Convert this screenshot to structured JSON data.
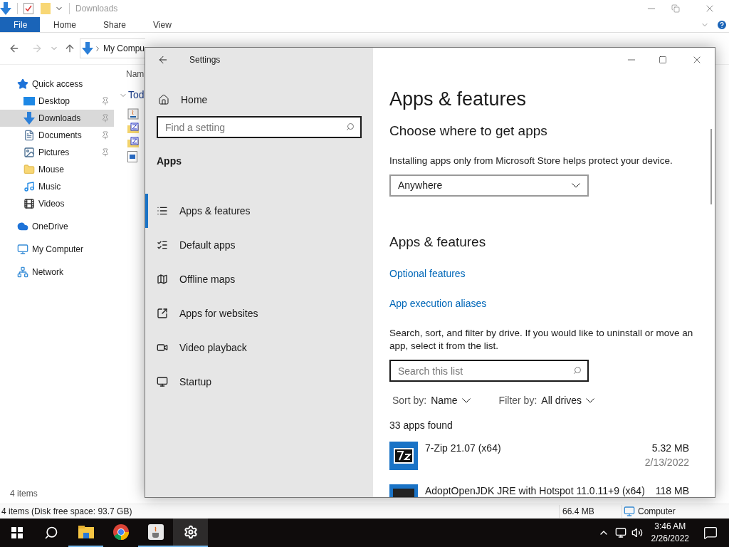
{
  "explorer": {
    "title": "Downloads",
    "ribbon_tabs": [
      {
        "label": "File",
        "selected": true
      },
      {
        "label": "Home",
        "selected": false
      },
      {
        "label": "Share",
        "selected": false
      },
      {
        "label": "View",
        "selected": false
      }
    ],
    "breadcrumb": "My Compu",
    "nav": [
      {
        "label": "Quick access",
        "kind": "star",
        "selected": false,
        "pinned": false,
        "group": true
      },
      {
        "label": "Desktop",
        "kind": "desktop",
        "selected": false,
        "pinned": true,
        "group": false
      },
      {
        "label": "Downloads",
        "kind": "download",
        "selected": true,
        "pinned": true,
        "group": false
      },
      {
        "label": "Documents",
        "kind": "document",
        "selected": false,
        "pinned": true,
        "group": false
      },
      {
        "label": "Pictures",
        "kind": "picture",
        "selected": false,
        "pinned": true,
        "group": false
      },
      {
        "label": "Mouse",
        "kind": "folder",
        "selected": false,
        "pinned": false,
        "group": false
      },
      {
        "label": "Music",
        "kind": "music",
        "selected": false,
        "pinned": false,
        "group": false
      },
      {
        "label": "Videos",
        "kind": "video",
        "selected": false,
        "pinned": false,
        "group": false
      },
      {
        "label": "OneDrive",
        "kind": "cloud",
        "selected": false,
        "pinned": false,
        "group": true
      },
      {
        "label": "My Computer",
        "kind": "computer",
        "selected": false,
        "pinned": false,
        "group": true
      },
      {
        "label": "Network",
        "kind": "network",
        "selected": false,
        "pinned": false,
        "group": true
      }
    ],
    "column_header": "Nam",
    "group_header": "Tod",
    "files": [
      {
        "kind": "java"
      },
      {
        "kind": "zip"
      },
      {
        "kind": "zip"
      },
      {
        "kind": "doc"
      }
    ],
    "item_count": "4 items",
    "status": "4 items (Disk free space: 93.7 GB)",
    "status_size": "66.4 MB",
    "status_location": "Computer"
  },
  "settings": {
    "title": "Settings",
    "home": "Home",
    "search_placeholder": "Find a setting",
    "section": "Apps",
    "nav": [
      {
        "label": "Apps & features",
        "kind": "list",
        "selected": true
      },
      {
        "label": "Default apps",
        "kind": "checklist",
        "selected": false
      },
      {
        "label": "Offline maps",
        "kind": "map",
        "selected": false
      },
      {
        "label": "Apps for websites",
        "kind": "web",
        "selected": false
      },
      {
        "label": "Video playback",
        "kind": "video",
        "selected": false
      },
      {
        "label": "Startup",
        "kind": "startup",
        "selected": false
      }
    ],
    "heading": "Apps & features",
    "subheading": "Choose where to get apps",
    "store_text": "Installing apps only from Microsoft Store helps protect your device.",
    "source": "Anywhere",
    "section2": "Apps & features",
    "links": [
      "Optional features",
      "App execution aliases"
    ],
    "list_text": "Search, sort, and filter by drive. If you would like to uninstall or move an app, select it from the list.",
    "list_search_placeholder": "Search this list",
    "sort_label": "Sort by:",
    "sort_value": "Name",
    "filter_label": "Filter by:",
    "filter_value": "All drives",
    "count": "33 apps found",
    "apps": [
      {
        "kind": "archiver",
        "name": "7-Zip 21.07 (x64)",
        "size": "5.32 MB",
        "date": "2/13/2022"
      },
      {
        "kind": "runtime",
        "name": "AdoptOpenJDK JRE with Hotspot 11.0.11+9 (x64)",
        "size": "118 MB"
      }
    ]
  },
  "taskbar": {
    "apps": [
      {
        "kind": "explorer",
        "open": true,
        "active": false
      },
      {
        "kind": "chrome",
        "open": false,
        "active": false
      },
      {
        "kind": "java",
        "open": true,
        "active": false
      },
      {
        "kind": "settings",
        "open": true,
        "active": true
      }
    ],
    "time": "3:46 AM",
    "date": "2/26/2022"
  }
}
